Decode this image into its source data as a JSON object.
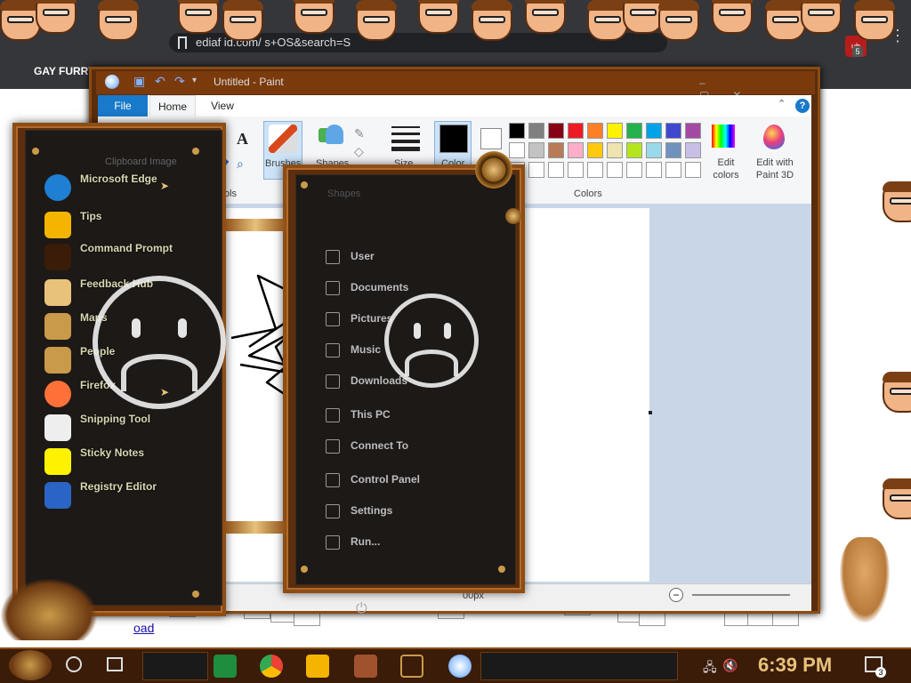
{
  "browser": {
    "url": "ediaf             id.com/            s+OS&search=S",
    "bookmark": "GAY FURRY",
    "extension_badge": "ub",
    "extension_count": "5",
    "page_link": "oad"
  },
  "paint": {
    "title": "Untitled - Paint",
    "tabs": {
      "file": "File",
      "home": "Home",
      "view": "View"
    },
    "help": "?",
    "groups": {
      "clipboard": "Clipboard",
      "image": "Image",
      "tools": "ols",
      "brushes": "Brushes",
      "shapes": "Shapes",
      "size": "Size",
      "color1": "Color",
      "colors": "Colors",
      "edit_colors": "Edit colors",
      "edit_paint3d": "Edit with Paint 3D"
    },
    "palette": [
      "#000000",
      "#7f7f7f",
      "#880015",
      "#ed1c24",
      "#ff7f27",
      "#fff200",
      "#22b14c",
      "#00a2e8",
      "#3f48cc",
      "#a349a4",
      "#ffffff",
      "#c3c3c3",
      "#b97a57",
      "#ffaec9",
      "#ffc90e",
      "#efe4b0",
      "#b5e61d",
      "#99d9ea",
      "#7092be",
      "#c8bfe7",
      "#ffffff",
      "#ffffff",
      "#ffffff",
      "#ffffff",
      "#ffffff",
      "#ffffff",
      "#ffffff",
      "#ffffff",
      "#ffffff",
      "#ffffff"
    ],
    "status_size": "00px"
  },
  "start_menu": {
    "apps": [
      {
        "label": "Microsoft Edge",
        "icon": "edge-icon",
        "has_arrow": true
      },
      {
        "label": "Tips",
        "icon": "lightbulb-icon",
        "has_arrow": false
      },
      {
        "label": "Command Prompt",
        "icon": "command-prompt-icon",
        "has_arrow": false
      },
      {
        "label": "Feedback Hub",
        "icon": "feedback-hub-icon",
        "has_arrow": false
      },
      {
        "label": "Maps",
        "icon": "maps-icon",
        "has_arrow": false
      },
      {
        "label": "People",
        "icon": "people-icon",
        "has_arrow": false
      },
      {
        "label": "Firefox",
        "icon": "firefox-icon",
        "has_arrow": true
      },
      {
        "label": "Snipping Tool",
        "icon": "snipping-tool-icon",
        "has_arrow": false
      },
      {
        "label": "Sticky Notes",
        "icon": "sticky-notes-icon",
        "has_arrow": false
      },
      {
        "label": "Registry Editor",
        "icon": "registry-editor-icon",
        "has_arrow": false
      }
    ],
    "apps_header": "Clipboard  Image",
    "places_header": "Shapes",
    "places": [
      {
        "label": "User",
        "icon": "user-icon"
      },
      {
        "label": "Documents",
        "icon": "documents-icon"
      },
      {
        "label": "Pictures",
        "icon": "pictures-icon"
      },
      {
        "label": "Music",
        "icon": "music-icon"
      },
      {
        "label": "Downloads",
        "icon": "downloads-icon"
      },
      {
        "label": "This PC",
        "icon": "this-pc-icon"
      },
      {
        "label": "Connect To",
        "icon": "connect-to-icon"
      },
      {
        "label": "Control Panel",
        "icon": "control-panel-icon"
      },
      {
        "label": "Settings",
        "icon": "settings-icon"
      },
      {
        "label": "Run...",
        "icon": "run-icon"
      }
    ]
  },
  "taskbar": {
    "clock": "6:39 PM",
    "notification_count": "3",
    "icons": [
      "cortana-icon",
      "task-view-icon",
      "sheets-icon",
      "chrome-icon",
      "file-explorer-icon",
      "game-icon",
      "command-prompt-icon",
      "paint-icon"
    ]
  },
  "colors": {
    "steam_brown": "#5b2e0e",
    "brass": "#c99a4a",
    "paint_blue": "#1979ca"
  }
}
